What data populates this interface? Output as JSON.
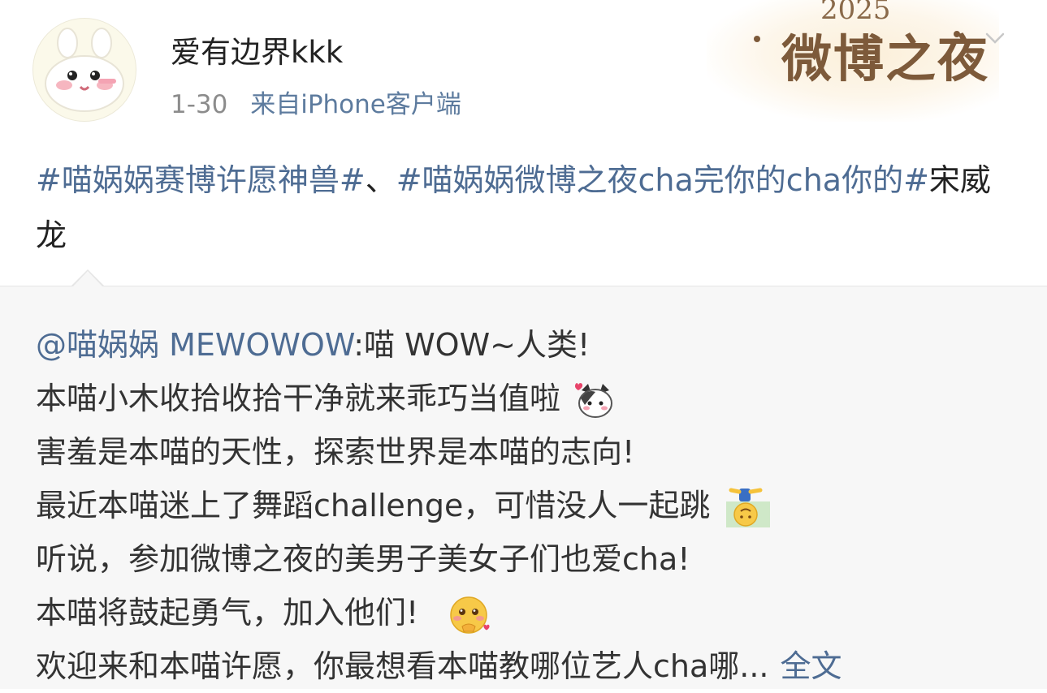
{
  "post": {
    "author": {
      "name": "爱有边界kkk"
    },
    "date": "1-30",
    "source": "来自iPhone客户端",
    "decoration": {
      "year": "2025",
      "title": "微博之夜"
    },
    "body": {
      "tag1": "#喵娲娲赛博许愿神兽#",
      "sep": "、",
      "tag2": "#喵娲娲微博之夜cha完你的cha你的#",
      "rest": "宋威龙"
    }
  },
  "repost": {
    "mention": "@喵娲娲 MEWOWOW",
    "first_line_rest": ":喵 WOW~人类!",
    "lines": [
      "本喵小木收拾收拾干净就来乖巧当值啦",
      "害羞是本喵的天性，探索世界是本喵的志向!",
      "最近本喵迷上了舞蹈challenge，可惜没人一起跳",
      "听说，参加微博之夜的美男子美女子们也爱cha!",
      "本喵将鼓起勇气，加入他们!"
    ],
    "last_line": "欢迎来和本喵许愿，你最想看本喵教哪位艺人cha哪...",
    "more_label": "全文"
  },
  "icons": {
    "cat": "cat-face-emoji",
    "dance": "upside-down-face-emoji",
    "shy": "shy-face-emoji",
    "more": "chevron-down-icon"
  },
  "colors": {
    "link": "#4e6c93",
    "meta": "#8c8c8c",
    "quote_bg": "#f7f7f7"
  }
}
